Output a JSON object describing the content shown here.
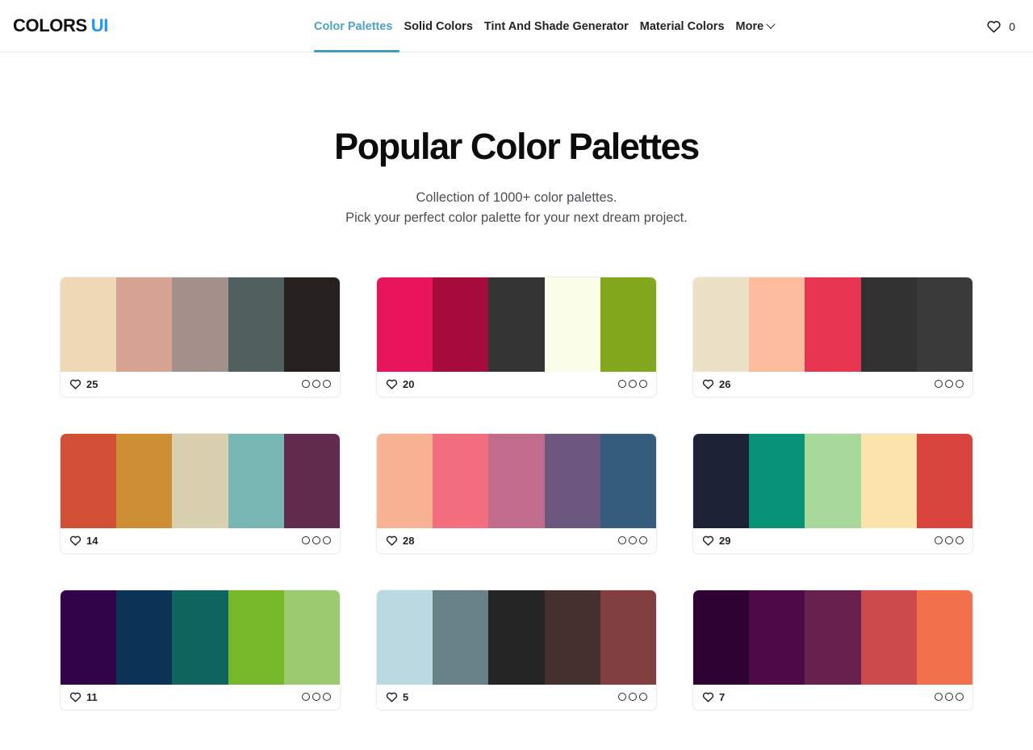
{
  "header": {
    "brand_main": "COLORS",
    "brand_accent": "UI",
    "brand_accent_color": "#2196f3",
    "nav": [
      {
        "label": "Color Palettes",
        "active": true
      },
      {
        "label": "Solid Colors",
        "active": false
      },
      {
        "label": "Tint And Shade Generator",
        "active": false
      },
      {
        "label": "Material Colors",
        "active": false
      },
      {
        "label": "More",
        "active": false,
        "has_chevron": true
      }
    ],
    "favorites": {
      "icon": "heart-icon",
      "count": "0"
    },
    "active_underline_color": "#3d9bc4"
  },
  "hero": {
    "title": "Popular Color Palettes",
    "subtitle_line1": "Collection of 1000+ color palettes.",
    "subtitle_line2": "Pick your perfect color palette for your next dream project."
  },
  "palettes": [
    {
      "likes": "25",
      "colors": [
        "#eed8b6",
        "#d6a291",
        "#a4908a",
        "#4f605f",
        "#26211e"
      ]
    },
    {
      "likes": "20",
      "colors": [
        "#e8155c",
        "#a50b3b",
        "#343434",
        "#fafee8",
        "#83a81e"
      ]
    },
    {
      "likes": "26",
      "colors": [
        "#ece0c6",
        "#fcbb9c",
        "#e73552",
        "#313131",
        "#3a3a3a"
      ]
    },
    {
      "likes": "14",
      "colors": [
        "#d14f35",
        "#ce8f34",
        "#d9d0af",
        "#79b7b5",
        "#622c4f"
      ]
    },
    {
      "likes": "28",
      "colors": [
        "#f8b394",
        "#f36f7f",
        "#c06c8a",
        "#6c577f",
        "#355c7d"
      ]
    },
    {
      "likes": "29",
      "colors": [
        "#1d2236",
        "#089379",
        "#a7d99b",
        "#fbe3ac",
        "#d8443c"
      ]
    },
    {
      "likes": "11",
      "colors": [
        "#310349",
        "#0c3256",
        "#10645f",
        "#76b829",
        "#9cca6e"
      ]
    },
    {
      "likes": "5",
      "colors": [
        "#b9dae1",
        "#688186",
        "#252525",
        "#45302f",
        "#813e3f"
      ]
    },
    {
      "likes": "7",
      "colors": [
        "#2e0333",
        "#4d0a49",
        "#66214f",
        "#cb4b4c",
        "#f2704b"
      ]
    }
  ],
  "card_footer": {
    "like_icon": "heart-icon",
    "menu_icon": "three-dots-icon"
  }
}
